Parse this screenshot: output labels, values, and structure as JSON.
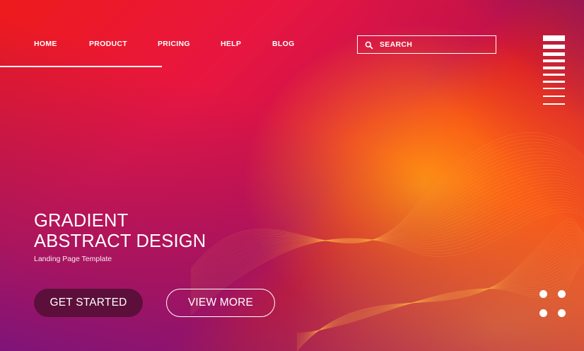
{
  "nav": {
    "items": [
      {
        "label": "HOME"
      },
      {
        "label": "PRODUCT"
      },
      {
        "label": "PRICING"
      },
      {
        "label": "HELP"
      },
      {
        "label": "BLOG"
      }
    ]
  },
  "search": {
    "placeholder": "SEARCH",
    "icon": "search-icon"
  },
  "menu": {
    "icon": "hamburger-menu-icon"
  },
  "hero": {
    "title_line1": "GRADIENT",
    "title_line2": "ABSTRACT DESIGN",
    "subtitle": "Landing Page Template"
  },
  "buttons": {
    "primary_label": "GET STARTED",
    "secondary_label": "VIEW MORE"
  },
  "decoration": {
    "dots_icon": "four-dots-icon"
  },
  "colors": {
    "primary_button_bg": "#5c0f3a",
    "text": "#ffffff",
    "gradient_red": "#ee1b1b",
    "gradient_orange": "#f6561e",
    "gradient_purple": "#6e1482"
  }
}
